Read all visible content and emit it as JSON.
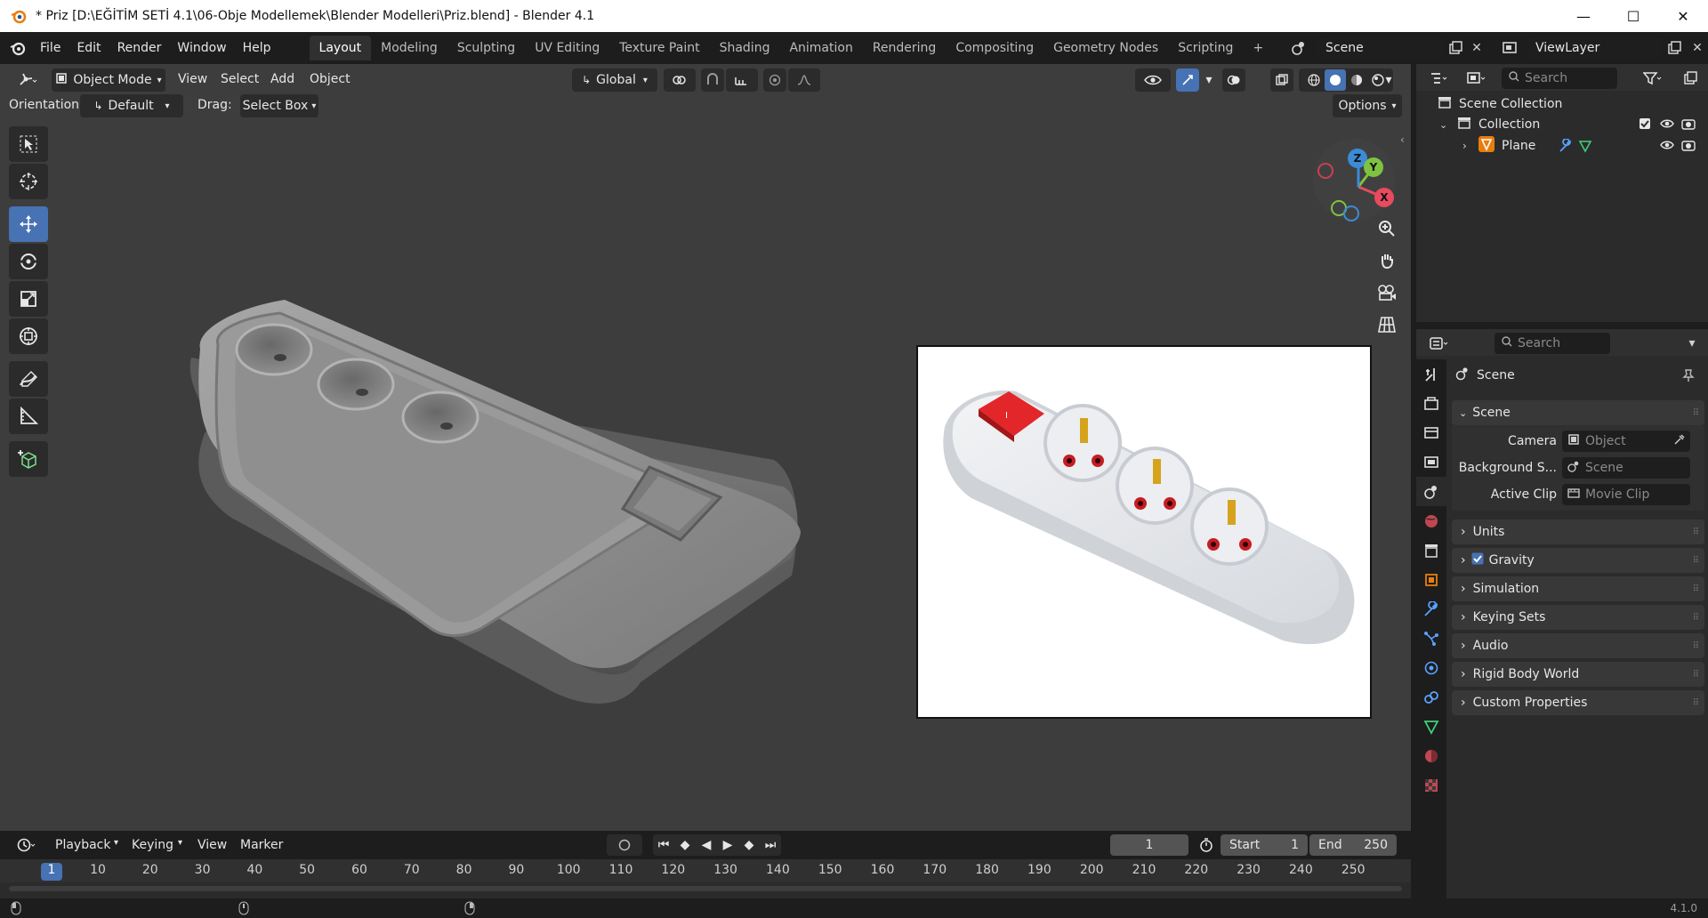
{
  "window": {
    "title": "* Priz [D:\\EĞİTİM SETİ 4.1\\06-Obje Modellemek\\Blender Modelleri\\Priz.blend] - Blender 4.1",
    "minimize": "—",
    "maximize": "☐",
    "close": "✕"
  },
  "menu": [
    "File",
    "Edit",
    "Render",
    "Window",
    "Help"
  ],
  "workspaces": [
    "Layout",
    "Modeling",
    "Sculpting",
    "UV Editing",
    "Texture Paint",
    "Shading",
    "Animation",
    "Rendering",
    "Compositing",
    "Geometry Nodes",
    "Scripting",
    "+"
  ],
  "scene_selector": {
    "value": "Scene"
  },
  "viewlayer_selector": {
    "value": "ViewLayer"
  },
  "viewport": {
    "mode": "Object Mode",
    "menus": [
      "View",
      "Select",
      "Add",
      "Object"
    ],
    "transform_orientation": "Global",
    "orientation_label": "Orientation:",
    "orientation_value": "Default",
    "drag_label": "Drag:",
    "drag_value": "Select Box",
    "options_label": "Options",
    "gizmo": {
      "z": "Z",
      "y": "Y",
      "x": "X"
    }
  },
  "timeline": {
    "menus": [
      "Playback",
      "Keying",
      "View",
      "Marker"
    ],
    "current_frame": "1",
    "start_label": "Start",
    "start_value": "1",
    "end_label": "End",
    "end_value": "250",
    "ruler": [
      "1",
      "10",
      "20",
      "30",
      "40",
      "50",
      "60",
      "70",
      "80",
      "90",
      "100",
      "110",
      "120",
      "130",
      "140",
      "150",
      "160",
      "170",
      "180",
      "190",
      "200",
      "210",
      "220",
      "230",
      "240",
      "250"
    ]
  },
  "outliner": {
    "search_placeholder": "Search",
    "scene_collection": "Scene Collection",
    "collection": "Collection",
    "object": "Plane"
  },
  "properties": {
    "search_placeholder": "Search",
    "context": "Scene",
    "panel_scene": "Scene",
    "camera_label": "Camera",
    "camera_value": "Object",
    "background_label": "Background S...",
    "background_value": "Scene",
    "active_clip_label": "Active Clip",
    "active_clip_value": "Movie Clip",
    "panels": [
      "Units",
      "Gravity",
      "Simulation",
      "Keying Sets",
      "Audio",
      "Rigid Body World",
      "Custom Properties"
    ]
  },
  "status": {
    "version": "4.1.0"
  },
  "colors": {
    "accent": "#4772b3",
    "orange": "#e87d0d"
  }
}
